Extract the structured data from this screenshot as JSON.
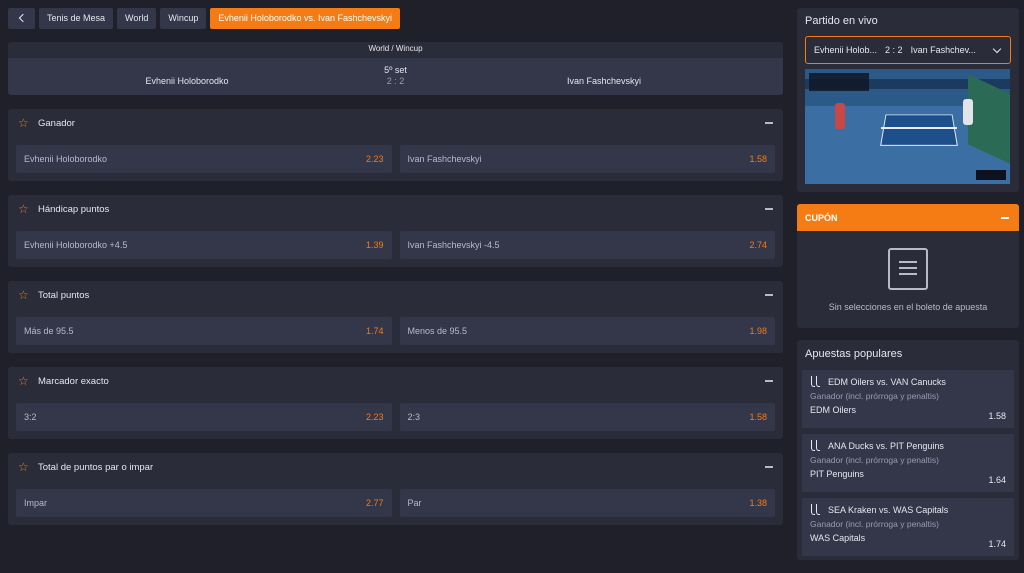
{
  "breadcrumbs": {
    "back_icon": "chevron-left-icon",
    "items": [
      "Tenis de Mesa",
      "World",
      "Wincup",
      "Evhenii Holoborodko vs. Ivan Fashchevskyi"
    ]
  },
  "scoreboard": {
    "competition": "World / Wincup",
    "player1": "Evhenii Holoborodko",
    "player2": "Ivan Fashchevskyi",
    "set": "5º set",
    "score": "2 : 2"
  },
  "markets": [
    {
      "title": "Ganador",
      "odds": [
        {
          "label": "Evhenii Holoborodko",
          "value": "2.23"
        },
        {
          "label": "Ivan Fashchevskyi",
          "value": "1.58"
        }
      ]
    },
    {
      "title": "Hándicap puntos",
      "odds": [
        {
          "label": "Evhenii Holoborodko  +4.5",
          "value": "1.39"
        },
        {
          "label": "Ivan Fashchevskyi  -4.5",
          "value": "2.74"
        }
      ]
    },
    {
      "title": "Total puntos",
      "odds": [
        {
          "label": "Más de 95.5",
          "value": "1.74"
        },
        {
          "label": "Menos de 95.5",
          "value": "1.98"
        }
      ]
    },
    {
      "title": "Marcador exacto",
      "odds": [
        {
          "label": "3:2",
          "value": "2.23"
        },
        {
          "label": "2:3",
          "value": "1.58"
        }
      ]
    },
    {
      "title": "Total de puntos par o impar",
      "odds": [
        {
          "label": "Impar",
          "value": "2.77"
        },
        {
          "label": "Par",
          "value": "1.38"
        }
      ]
    }
  ],
  "live": {
    "title": "Partido en vivo",
    "match_p1": "Evhenii Holob...",
    "match_score": "2 : 2",
    "match_p2": "Ivan Fashchev..."
  },
  "coupon": {
    "title": "CUPÓN",
    "empty_text": "Sin selecciones en el boleto de apuesta"
  },
  "popular": {
    "title": "Apuestas populares",
    "items": [
      {
        "match": "EDM Oilers vs. VAN Canucks",
        "market": "Ganador (incl. prórroga y penaltis)",
        "selection": "EDM Oilers",
        "odd": "1.58"
      },
      {
        "match": "ANA Ducks vs. PIT Penguins",
        "market": "Ganador (incl. prórroga y penaltis)",
        "selection": "PIT Penguins",
        "odd": "1.64"
      },
      {
        "match": "SEA Kraken vs. WAS Capitals",
        "market": "Ganador (incl. prórroga y penaltis)",
        "selection": "WAS Capitals",
        "odd": "1.74"
      }
    ]
  },
  "colors": {
    "accent": "#f57c14",
    "background": "#1f2029",
    "panel": "#2a2c3a",
    "cell": "#34364a"
  }
}
